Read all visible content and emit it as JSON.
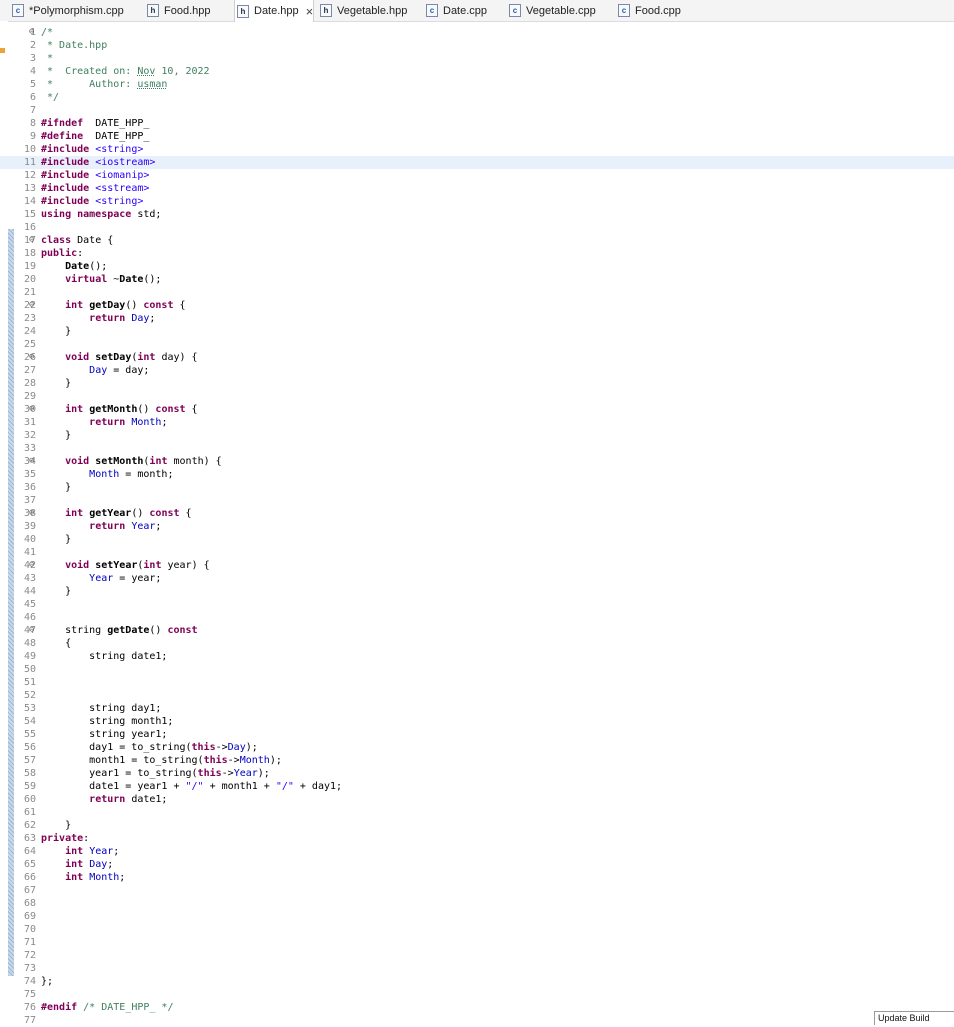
{
  "tabs": [
    {
      "label": "*Polymorphism.cpp",
      "icon": "c-source-file-icon",
      "icon_glyph": "c",
      "active": false
    },
    {
      "label": "Food.hpp",
      "icon": "header-file-icon",
      "icon_glyph": "h",
      "active": false
    },
    {
      "label": "Date.hpp",
      "icon": "header-file-icon",
      "icon_glyph": "h",
      "active": true,
      "close": "×"
    },
    {
      "label": "Vegetable.hpp",
      "icon": "header-file-icon",
      "icon_glyph": "h",
      "active": false
    },
    {
      "label": "Date.cpp",
      "icon": "c-source-file-icon",
      "icon_glyph": "c",
      "active": false
    },
    {
      "label": "Vegetable.cpp",
      "icon": "c-source-file-icon",
      "icon_glyph": "c",
      "active": false
    },
    {
      "label": "Food.cpp",
      "icon": "c-source-file-icon",
      "icon_glyph": "c",
      "active": false
    }
  ],
  "editor": {
    "current_line": 11,
    "fold_glyph": "⊖",
    "lines": [
      {
        "n": "1",
        "fold": true,
        "t": [
          [
            "cm",
            "/*"
          ]
        ]
      },
      {
        "n": "2",
        "t": [
          [
            "cm",
            " * Date.hpp"
          ]
        ]
      },
      {
        "n": "3",
        "t": [
          [
            "cm",
            " *"
          ]
        ]
      },
      {
        "n": "4",
        "t": [
          [
            "cm",
            " *  Created on: "
          ],
          [
            "cmul",
            "Nov"
          ],
          [
            "cm",
            " 10, 2022"
          ]
        ]
      },
      {
        "n": "5",
        "t": [
          [
            "cm",
            " *      Author: "
          ],
          [
            "cmul",
            "usman"
          ]
        ]
      },
      {
        "n": "6",
        "t": [
          [
            "cm",
            " */"
          ]
        ]
      },
      {
        "n": "7",
        "t": []
      },
      {
        "n": "8",
        "t": [
          [
            "kw",
            "#ifndef"
          ],
          [
            "",
            "  DATE_HPP_"
          ]
        ]
      },
      {
        "n": "9",
        "t": [
          [
            "kw",
            "#define"
          ],
          [
            "",
            "  DATE_HPP_"
          ]
        ]
      },
      {
        "n": "10",
        "t": [
          [
            "kw",
            "#include"
          ],
          [
            "",
            " "
          ],
          [
            "inc",
            "<string>"
          ]
        ]
      },
      {
        "n": "11",
        "t": [
          [
            "kw",
            "#include"
          ],
          [
            "",
            " "
          ],
          [
            "inc",
            "<iostream>"
          ]
        ]
      },
      {
        "n": "12",
        "t": [
          [
            "kw",
            "#include"
          ],
          [
            "",
            " "
          ],
          [
            "inc",
            "<iomanip>"
          ]
        ]
      },
      {
        "n": "13",
        "t": [
          [
            "kw",
            "#include"
          ],
          [
            "",
            " "
          ],
          [
            "inc",
            "<sstream>"
          ]
        ]
      },
      {
        "n": "14",
        "t": [
          [
            "kw",
            "#include"
          ],
          [
            "",
            " "
          ],
          [
            "inc",
            "<string>"
          ]
        ]
      },
      {
        "n": "15",
        "t": [
          [
            "kw",
            "using namespace"
          ],
          [
            "",
            " std;"
          ]
        ]
      },
      {
        "n": "16",
        "t": []
      },
      {
        "n": "17",
        "fold": true,
        "t": [
          [
            "kw",
            "class"
          ],
          [
            "",
            " Date {"
          ]
        ]
      },
      {
        "n": "18",
        "t": [
          [
            "kw",
            "public"
          ],
          [
            "",
            ":"
          ]
        ]
      },
      {
        "n": "19",
        "t": [
          [
            "",
            "    "
          ],
          [
            "fn",
            "Date"
          ],
          [
            "",
            "();"
          ]
        ]
      },
      {
        "n": "20",
        "t": [
          [
            "",
            "    "
          ],
          [
            "kw",
            "virtual"
          ],
          [
            "",
            " ~"
          ],
          [
            "fn",
            "Date"
          ],
          [
            "",
            "();"
          ]
        ]
      },
      {
        "n": "21",
        "t": []
      },
      {
        "n": "22",
        "fold": true,
        "t": [
          [
            "",
            "    "
          ],
          [
            "kw",
            "int"
          ],
          [
            "",
            " "
          ],
          [
            "fn",
            "getDay"
          ],
          [
            "",
            "() "
          ],
          [
            "kw",
            "const"
          ],
          [
            "",
            " {"
          ]
        ]
      },
      {
        "n": "23",
        "t": [
          [
            "",
            "        "
          ],
          [
            "kw",
            "return"
          ],
          [
            "",
            " "
          ],
          [
            "fld",
            "Day"
          ],
          [
            "",
            ";"
          ]
        ]
      },
      {
        "n": "24",
        "t": [
          [
            "",
            "    }"
          ]
        ]
      },
      {
        "n": "25",
        "t": []
      },
      {
        "n": "26",
        "fold": true,
        "t": [
          [
            "",
            "    "
          ],
          [
            "kw",
            "void"
          ],
          [
            "",
            " "
          ],
          [
            "fn",
            "setDay"
          ],
          [
            "",
            "("
          ],
          [
            "kw",
            "int"
          ],
          [
            "",
            " day) {"
          ]
        ]
      },
      {
        "n": "27",
        "t": [
          [
            "",
            "        "
          ],
          [
            "fld",
            "Day"
          ],
          [
            "",
            " = day;"
          ]
        ]
      },
      {
        "n": "28",
        "t": [
          [
            "",
            "    }"
          ]
        ]
      },
      {
        "n": "29",
        "t": []
      },
      {
        "n": "30",
        "fold": true,
        "t": [
          [
            "",
            "    "
          ],
          [
            "kw",
            "int"
          ],
          [
            "",
            " "
          ],
          [
            "fn",
            "getMonth"
          ],
          [
            "",
            "() "
          ],
          [
            "kw",
            "const"
          ],
          [
            "",
            " {"
          ]
        ]
      },
      {
        "n": "31",
        "t": [
          [
            "",
            "        "
          ],
          [
            "kw",
            "return"
          ],
          [
            "",
            " "
          ],
          [
            "fld",
            "Month"
          ],
          [
            "",
            ";"
          ]
        ]
      },
      {
        "n": "32",
        "t": [
          [
            "",
            "    }"
          ]
        ]
      },
      {
        "n": "33",
        "t": []
      },
      {
        "n": "34",
        "fold": true,
        "t": [
          [
            "",
            "    "
          ],
          [
            "kw",
            "void"
          ],
          [
            "",
            " "
          ],
          [
            "fn",
            "setMonth"
          ],
          [
            "",
            "("
          ],
          [
            "kw",
            "int"
          ],
          [
            "",
            " month) {"
          ]
        ]
      },
      {
        "n": "35",
        "t": [
          [
            "",
            "        "
          ],
          [
            "fld",
            "Month"
          ],
          [
            "",
            " = month;"
          ]
        ]
      },
      {
        "n": "36",
        "t": [
          [
            "",
            "    }"
          ]
        ]
      },
      {
        "n": "37",
        "t": []
      },
      {
        "n": "38",
        "fold": true,
        "t": [
          [
            "",
            "    "
          ],
          [
            "kw",
            "int"
          ],
          [
            "",
            " "
          ],
          [
            "fn",
            "getYear"
          ],
          [
            "",
            "() "
          ],
          [
            "kw",
            "const"
          ],
          [
            "",
            " {"
          ]
        ]
      },
      {
        "n": "39",
        "t": [
          [
            "",
            "        "
          ],
          [
            "kw",
            "return"
          ],
          [
            "",
            " "
          ],
          [
            "fld",
            "Year"
          ],
          [
            "",
            ";"
          ]
        ]
      },
      {
        "n": "40",
        "t": [
          [
            "",
            "    }"
          ]
        ]
      },
      {
        "n": "41",
        "t": []
      },
      {
        "n": "42",
        "fold": true,
        "t": [
          [
            "",
            "    "
          ],
          [
            "kw",
            "void"
          ],
          [
            "",
            " "
          ],
          [
            "fn",
            "setYear"
          ],
          [
            "",
            "("
          ],
          [
            "kw",
            "int"
          ],
          [
            "",
            " year) {"
          ]
        ]
      },
      {
        "n": "43",
        "t": [
          [
            "",
            "        "
          ],
          [
            "fld",
            "Year"
          ],
          [
            "",
            " = year;"
          ]
        ]
      },
      {
        "n": "44",
        "t": [
          [
            "",
            "    }"
          ]
        ]
      },
      {
        "n": "45",
        "t": []
      },
      {
        "n": "46",
        "t": []
      },
      {
        "n": "47",
        "fold": true,
        "t": [
          [
            "",
            "    string "
          ],
          [
            "fn",
            "getDate"
          ],
          [
            "",
            "() "
          ],
          [
            "kw",
            "const"
          ]
        ]
      },
      {
        "n": "48",
        "t": [
          [
            "",
            "    {"
          ]
        ]
      },
      {
        "n": "49",
        "t": [
          [
            "",
            "        string date1;"
          ]
        ]
      },
      {
        "n": "50",
        "t": []
      },
      {
        "n": "51",
        "t": []
      },
      {
        "n": "52",
        "t": []
      },
      {
        "n": "53",
        "t": [
          [
            "",
            "        string day1;"
          ]
        ]
      },
      {
        "n": "54",
        "t": [
          [
            "",
            "        string month1;"
          ]
        ]
      },
      {
        "n": "55",
        "t": [
          [
            "",
            "        string year1;"
          ]
        ]
      },
      {
        "n": "56",
        "t": [
          [
            "",
            "        day1 = to_string("
          ],
          [
            "kw",
            "this"
          ],
          [
            "",
            "->"
          ],
          [
            "fld",
            "Day"
          ],
          [
            "",
            ");"
          ]
        ]
      },
      {
        "n": "57",
        "t": [
          [
            "",
            "        month1 = to_string("
          ],
          [
            "kw",
            "this"
          ],
          [
            "",
            "->"
          ],
          [
            "fld",
            "Month"
          ],
          [
            "",
            ");"
          ]
        ]
      },
      {
        "n": "58",
        "t": [
          [
            "",
            "        year1 = to_string("
          ],
          [
            "kw",
            "this"
          ],
          [
            "",
            "->"
          ],
          [
            "fld",
            "Year"
          ],
          [
            "",
            ");"
          ]
        ]
      },
      {
        "n": "59",
        "t": [
          [
            "",
            "        date1 = year1 + "
          ],
          [
            "str",
            "\"/\""
          ],
          [
            "",
            " + month1 + "
          ],
          [
            "str",
            "\"/\""
          ],
          [
            "",
            " + day1;"
          ]
        ]
      },
      {
        "n": "60",
        "t": [
          [
            "",
            "        "
          ],
          [
            "kw",
            "return"
          ],
          [
            "",
            " date1;"
          ]
        ]
      },
      {
        "n": "61",
        "t": []
      },
      {
        "n": "62",
        "t": [
          [
            "",
            "    }"
          ]
        ]
      },
      {
        "n": "63",
        "t": [
          [
            "kw",
            "private"
          ],
          [
            "",
            ":"
          ]
        ]
      },
      {
        "n": "64",
        "t": [
          [
            "",
            "    "
          ],
          [
            "kw",
            "int"
          ],
          [
            "",
            " "
          ],
          [
            "fld",
            "Year"
          ],
          [
            "",
            ";"
          ]
        ]
      },
      {
        "n": "65",
        "t": [
          [
            "",
            "    "
          ],
          [
            "kw",
            "int"
          ],
          [
            "",
            " "
          ],
          [
            "fld",
            "Day"
          ],
          [
            "",
            ";"
          ]
        ]
      },
      {
        "n": "66",
        "t": [
          [
            "",
            "    "
          ],
          [
            "kw",
            "int"
          ],
          [
            "",
            " "
          ],
          [
            "fld",
            "Month"
          ],
          [
            "",
            ";"
          ]
        ]
      },
      {
        "n": "67",
        "t": []
      },
      {
        "n": "68",
        "t": []
      },
      {
        "n": "69",
        "t": []
      },
      {
        "n": "70",
        "t": []
      },
      {
        "n": "71",
        "t": []
      },
      {
        "n": "72",
        "t": []
      },
      {
        "n": "73",
        "t": []
      },
      {
        "n": "74",
        "t": [
          [
            "",
            "};"
          ]
        ]
      },
      {
        "n": "75",
        "t": []
      },
      {
        "n": "76",
        "t": [
          [
            "kw",
            "#endif"
          ],
          [
            "",
            " "
          ],
          [
            "cm",
            "/* DATE_HPP_ */"
          ]
        ]
      },
      {
        "n": "77",
        "t": []
      }
    ]
  },
  "tooltip": {
    "text": "Update Build"
  },
  "colors": {
    "keyword": "#7f0055",
    "comment": "#3f7f5f",
    "string": "#2a00ff",
    "field": "#0000c0",
    "current_line": "#e8f0fb",
    "fold_ruler": "#9cb6d4"
  }
}
